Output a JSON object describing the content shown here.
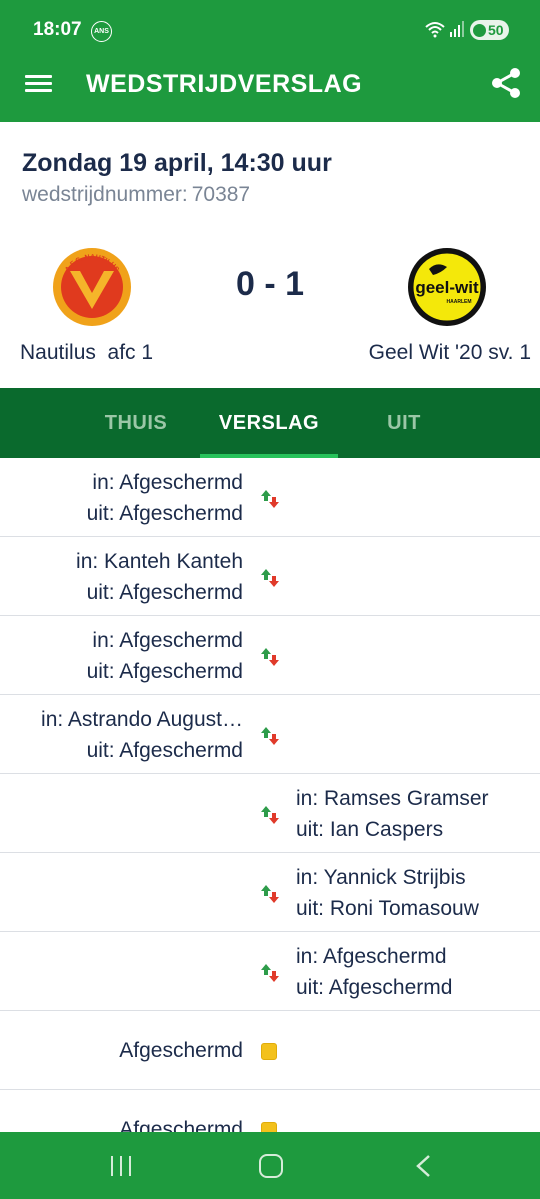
{
  "status_bar": {
    "time": "18:07",
    "battery": "50",
    "app_badge": "ANS"
  },
  "app_bar": {
    "title": "WEDSTRIJDVERSLAG",
    "menu_icon": "hamburger-menu-icon",
    "share_icon": "share-icon"
  },
  "match": {
    "date": "Zondag 19 april, 14:30 uur",
    "number_label": "wedstrijdnummer:",
    "number": "70387",
    "score": "0 - 1",
    "home_team": "Nautilus  afc 1",
    "away_team": "Geel Wit '20 sv. 1",
    "home_logo_text": "A.F.C. NAUTILUS",
    "away_logo_text": "geel-wit",
    "away_logo_subtext": "HAARLEM"
  },
  "tabs": [
    {
      "label": "THUIS",
      "active": false
    },
    {
      "label": "VERSLAG",
      "active": true
    },
    {
      "label": "UIT",
      "active": false
    }
  ],
  "events": [
    {
      "side": "home",
      "type": "substitution",
      "line1": "in: Afgeschermd",
      "line2": "uit: Afgeschermd"
    },
    {
      "side": "home",
      "type": "substitution",
      "line1": "in: Kanteh Kanteh",
      "line2": "uit: Afgeschermd"
    },
    {
      "side": "home",
      "type": "substitution",
      "line1": "in: Afgeschermd",
      "line2": "uit: Afgeschermd"
    },
    {
      "side": "home",
      "type": "substitution",
      "line1": "in: Astrando August…",
      "line2": "uit: Afgeschermd"
    },
    {
      "side": "away",
      "type": "substitution",
      "line1": "in: Ramses Gramser",
      "line2": "uit: Ian Caspers"
    },
    {
      "side": "away",
      "type": "substitution",
      "line1": "in: Yannick Strijbis",
      "line2": "uit: Roni Tomasouw"
    },
    {
      "side": "away",
      "type": "substitution",
      "line1": "in: Afgeschermd",
      "line2": "uit: Afgeschermd"
    },
    {
      "side": "home",
      "type": "yellow-card",
      "line1": "Afgeschermd"
    },
    {
      "side": "home",
      "type": "yellow-card",
      "line1": "Afgeschermd"
    }
  ],
  "colors": {
    "primary": "#1e9a3e",
    "tab_bar": "#0a6a2d",
    "tab_indicator": "#27c25b",
    "text": "#1c2b4a",
    "muted": "#7a8595",
    "yellow_card": "#f3c11b"
  }
}
